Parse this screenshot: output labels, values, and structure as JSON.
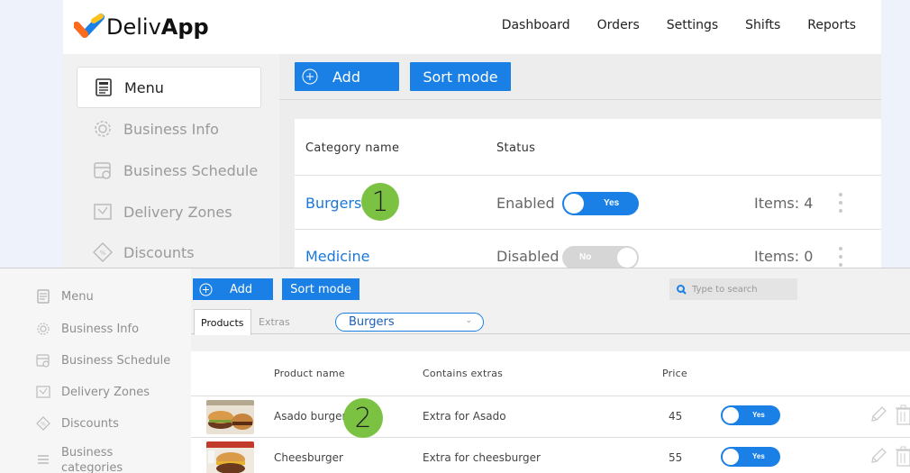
{
  "back": {
    "brand": {
      "name_regular": "Deliv",
      "name_bold": "App"
    },
    "nav": [
      "Dashboard",
      "Orders",
      "Settings",
      "Shifts",
      "Reports"
    ],
    "sidebar": [
      {
        "label": "Menu",
        "icon": "menu-icon",
        "active": true
      },
      {
        "label": "Business Info",
        "icon": "gear-icon"
      },
      {
        "label": "Business Schedule",
        "icon": "calendar-clock-icon"
      },
      {
        "label": "Delivery Zones",
        "icon": "map-icon"
      },
      {
        "label": "Discounts",
        "icon": "discount-icon"
      }
    ],
    "toolbar": {
      "add_label": "Add",
      "sort_label": "Sort mode"
    },
    "table": {
      "headers": {
        "name": "Category name",
        "status": "Status"
      },
      "rows": [
        {
          "name": "Burgers",
          "status": "Enabled",
          "toggle": "Yes",
          "items": "Items: 4"
        },
        {
          "name": "Medicine",
          "status": "Disabled",
          "toggle": "No",
          "items": "Items: 0"
        }
      ]
    },
    "callout": "1"
  },
  "front": {
    "sidebar": [
      {
        "label": "Menu",
        "icon": "menu-icon"
      },
      {
        "label": "Business Info",
        "icon": "gear-icon"
      },
      {
        "label": "Business Schedule",
        "icon": "calendar-clock-icon"
      },
      {
        "label": "Delivery Zones",
        "icon": "map-icon"
      },
      {
        "label": "Discounts",
        "icon": "discount-icon"
      },
      {
        "label": "Business",
        "label2": "categories",
        "icon": "list-icon"
      }
    ],
    "toolbar": {
      "add_label": "Add",
      "sort_label": "Sort mode",
      "search_placeholder": "Type to search"
    },
    "tabs": {
      "products": "Products",
      "extras": "Extras",
      "category_select": "Burgers"
    },
    "table": {
      "headers": {
        "name": "Product name",
        "extras": "Contains extras",
        "price": "Price"
      },
      "rows": [
        {
          "name": "Asado burger",
          "extras": "Extra for Asado",
          "price": "45",
          "toggle": "Yes"
        },
        {
          "name": "Cheesburger",
          "extras": "Extra for cheesburger",
          "price": "55",
          "toggle": "Yes"
        }
      ]
    },
    "callout": "2"
  },
  "colors": {
    "accent": "#1a80e5",
    "callout": "#7cc242",
    "link": "#1a78d8",
    "toggle_off": "#d6d6d6"
  }
}
